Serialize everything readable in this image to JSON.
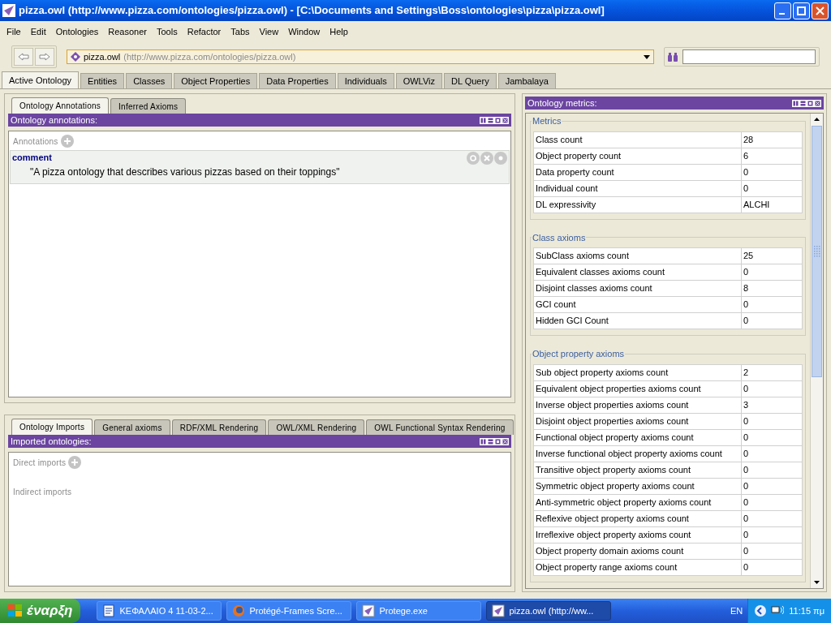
{
  "window": {
    "title": "pizza.owl (http://www.pizza.com/ontologies/pizza.owl) - [C:\\Documents and Settings\\Boss\\ontologies\\pizza\\pizza.owl]"
  },
  "menu": [
    "File",
    "Edit",
    "Ontologies",
    "Reasoner",
    "Tools",
    "Refactor",
    "Tabs",
    "View",
    "Window",
    "Help"
  ],
  "toolbar": {
    "ontology_name": "pizza.owl",
    "ontology_iri": "(http://www.pizza.com/ontologies/pizza.owl)"
  },
  "tabs": [
    {
      "label": "Active Ontology",
      "selected": true
    },
    {
      "label": "Entities",
      "selected": false
    },
    {
      "label": "Classes",
      "selected": false
    },
    {
      "label": "Object Properties",
      "selected": false
    },
    {
      "label": "Data Properties",
      "selected": false
    },
    {
      "label": "Individuals",
      "selected": false
    },
    {
      "label": "OWLViz",
      "selected": false
    },
    {
      "label": "DL Query",
      "selected": false
    },
    {
      "label": "Jambalaya",
      "selected": false
    }
  ],
  "annotations_panel": {
    "tabs": [
      {
        "label": "Ontology Annotations",
        "selected": true
      },
      {
        "label": "Inferred Axioms",
        "selected": false
      }
    ],
    "header": "Ontology annotations:",
    "section_label": "Annotations",
    "annotation": {
      "property": "comment",
      "value": "\"A pizza ontology that describes various pizzas based on their toppings\""
    }
  },
  "imports_panel": {
    "tabs": [
      {
        "label": "Ontology Imports",
        "selected": true
      },
      {
        "label": "General axioms",
        "selected": false
      },
      {
        "label": "RDF/XML Rendering",
        "selected": false
      },
      {
        "label": "OWL/XML Rendering",
        "selected": false
      },
      {
        "label": "OWL Functional Syntax Rendering",
        "selected": false
      }
    ],
    "header": "Imported ontologies:",
    "direct_label": "Direct imports",
    "indirect_label": "Indirect imports"
  },
  "metrics_panel": {
    "header": "Ontology metrics:",
    "groups": [
      {
        "title": "Metrics",
        "rows": [
          {
            "name": "Class count",
            "value": "28"
          },
          {
            "name": "Object property count",
            "value": "6"
          },
          {
            "name": "Data property count",
            "value": "0"
          },
          {
            "name": "Individual count",
            "value": "0"
          },
          {
            "name": "DL expressivity",
            "value": "ALCHI"
          }
        ]
      },
      {
        "title": "Class axioms",
        "rows": [
          {
            "name": "SubClass axioms count",
            "value": "25"
          },
          {
            "name": "Equivalent classes axioms count",
            "value": "0"
          },
          {
            "name": "Disjoint classes axioms count",
            "value": "8"
          },
          {
            "name": "GCI count",
            "value": "0"
          },
          {
            "name": "Hidden GCI Count",
            "value": "0"
          }
        ]
      },
      {
        "title": "Object property axioms",
        "rows": [
          {
            "name": "Sub object property axioms count",
            "value": "2"
          },
          {
            "name": "Equivalent object properties axioms count",
            "value": "0"
          },
          {
            "name": "Inverse object properties axioms count",
            "value": "3"
          },
          {
            "name": "Disjoint object properties axioms count",
            "value": "0"
          },
          {
            "name": "Functional object property axioms count",
            "value": "0"
          },
          {
            "name": "Inverse functional object property axioms count",
            "value": "0"
          },
          {
            "name": "Transitive object property axioms count",
            "value": "0"
          },
          {
            "name": "Symmetric object property axioms count",
            "value": "0"
          },
          {
            "name": "Anti-symmetric object property axioms count",
            "value": "0"
          },
          {
            "name": "Reflexive object property axioms count",
            "value": "0"
          },
          {
            "name": "Irreflexive object property axioms count",
            "value": "0"
          },
          {
            "name": "Object property domain axioms count",
            "value": "0"
          },
          {
            "name": "Object property range axioms count",
            "value": "0"
          }
        ]
      }
    ]
  },
  "taskbar": {
    "start": "έναρξη",
    "tasks": [
      {
        "label": "ΚΕΦΑΛΑΙΟ 4 11-03-2...",
        "selected": false,
        "kind": "document"
      },
      {
        "label": "Protégé-Frames Scre...",
        "selected": false,
        "kind": "browser"
      },
      {
        "label": "Protege.exe",
        "selected": false,
        "kind": "app"
      },
      {
        "label": "pizza.owl (http://ww...",
        "selected": true,
        "kind": "app"
      }
    ],
    "language": "EN",
    "time": "11:15 πμ"
  }
}
